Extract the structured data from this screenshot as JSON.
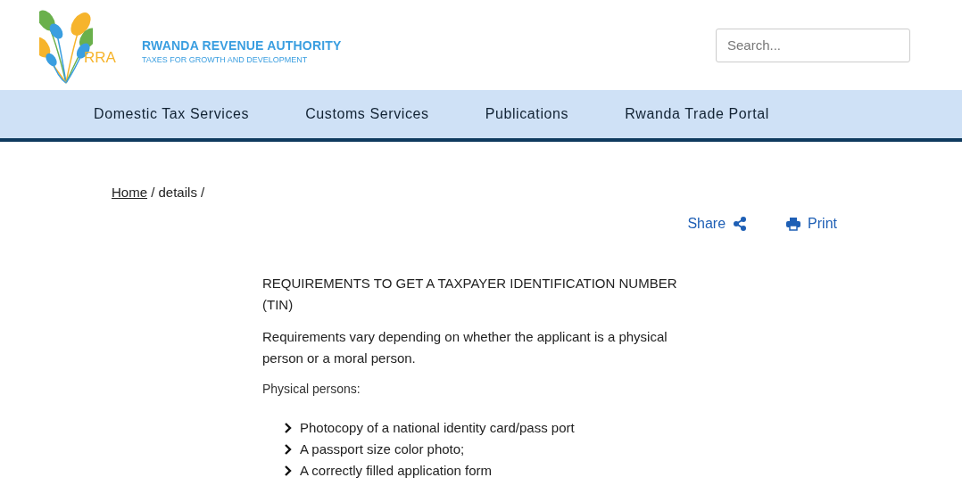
{
  "header": {
    "logo_text": "RRA",
    "org_name": "RWANDA REVENUE AUTHORITY",
    "tagline": "TAXES FOR GROWTH AND DEVELOPMENT",
    "search": {
      "placeholder": "Search..."
    }
  },
  "nav": [
    "Domestic Tax Services",
    "Customs Services",
    "Publications",
    "Rwanda Trade Portal"
  ],
  "breadcrumb": {
    "link": "Home",
    "rest": "/ details /"
  },
  "actions": {
    "share": "Share",
    "print": "Print"
  },
  "article": {
    "title": "REQUIREMENTS TO GET A TAXPAYER IDENTIFICATION NUMBER (TIN)",
    "intro": "Requirements vary depending on whether the applicant is a physical person or a moral person.",
    "subheading": "Physical persons:",
    "items": [
      "Photocopy of a national identity card/pass port",
      "A passport size color photo;",
      "A correctly filled application form"
    ]
  }
}
